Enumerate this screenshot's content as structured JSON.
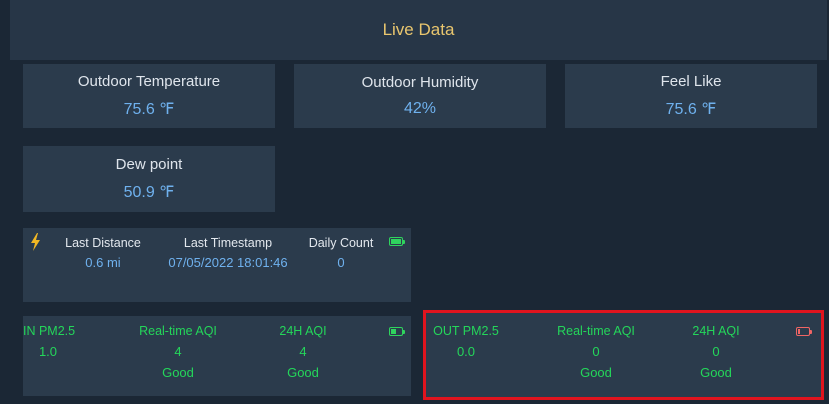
{
  "header": {
    "title": "Live Data"
  },
  "cards": {
    "outdoor_temperature": {
      "label": "Outdoor Temperature",
      "value": "75.6 ℉"
    },
    "outdoor_humidity": {
      "label": "Outdoor Humidity",
      "value": "42%"
    },
    "feel_like": {
      "label": "Feel Like",
      "value": "75.6 ℉"
    },
    "dew_point": {
      "label": "Dew point",
      "value": "50.9 ℉"
    }
  },
  "lightning": {
    "icon": "lightning-bolt-icon",
    "last_distance": {
      "label": "Last Distance",
      "value": "0.6 mi"
    },
    "last_timestamp": {
      "label": "Last Timestamp",
      "value": "07/05/2022 18:01:46"
    },
    "daily_count": {
      "label": "Daily Count",
      "value": "0"
    },
    "battery_level": 1.0,
    "battery_color": "#2fd45e"
  },
  "indoor_pm": {
    "pm": {
      "label": "IN PM2.5",
      "value": "1.0"
    },
    "realtime_aqi": {
      "label": "Real-time AQI",
      "value": "4",
      "status": "Good"
    },
    "aqi_24h": {
      "label": "24H AQI",
      "value": "4",
      "status": "Good"
    },
    "battery_level": 0.5,
    "battery_color": "#2fd45e"
  },
  "outdoor_pm": {
    "pm": {
      "label": "OUT PM2.5",
      "value": "0.0"
    },
    "realtime_aqi": {
      "label": "Real-time AQI",
      "value": "0",
      "status": "Good"
    },
    "aqi_24h": {
      "label": "24H AQI",
      "value": "0",
      "status": "Good"
    },
    "battery_level": 0.2,
    "battery_color": "#f06565"
  },
  "colors": {
    "title": "#e9c66e",
    "value_blue": "#6fb1ee",
    "aqi_green": "#24d65a",
    "highlight": "#e0141e"
  }
}
